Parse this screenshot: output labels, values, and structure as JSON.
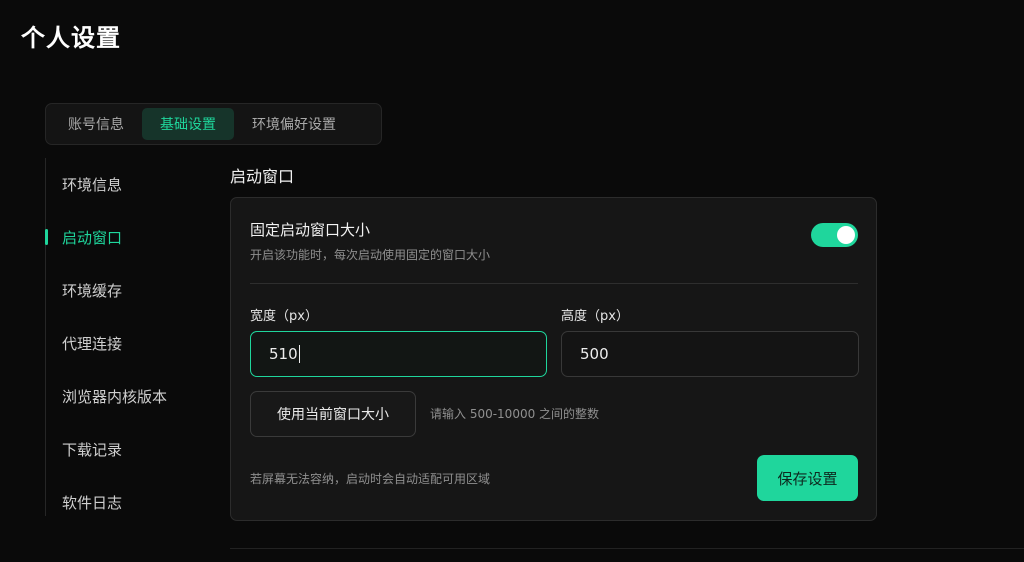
{
  "page": {
    "title": "个人设置"
  },
  "tabs": [
    {
      "label": "账号信息",
      "active": false
    },
    {
      "label": "基础设置",
      "active": true
    },
    {
      "label": "环境偏好设置",
      "active": false
    }
  ],
  "side_nav": [
    {
      "label": "环境信息",
      "active": false
    },
    {
      "label": "启动窗口",
      "active": true
    },
    {
      "label": "环境缓存",
      "active": false
    },
    {
      "label": "代理连接",
      "active": false
    },
    {
      "label": "浏览器内核版本",
      "active": false
    },
    {
      "label": "下载记录",
      "active": false
    },
    {
      "label": "软件日志",
      "active": false
    }
  ],
  "section": {
    "title": "启动窗口",
    "setting_label": "固定启动窗口大小",
    "setting_desc": "开启该功能时，每次启动使用固定的窗口大小",
    "toggle_on": true,
    "width_label": "宽度（px）",
    "width_value": "510",
    "height_label": "高度（px）",
    "height_value": "500",
    "use_current_label": "使用当前窗口大小",
    "hint": "请输入 500-10000 之间的整数",
    "footer_note": "若屏幕无法容纳，启动时会自动适配可用区域",
    "save_label": "保存设置"
  },
  "colors": {
    "accent": "#1fd69c",
    "background": "#0a0a0a",
    "card": "#161616"
  }
}
